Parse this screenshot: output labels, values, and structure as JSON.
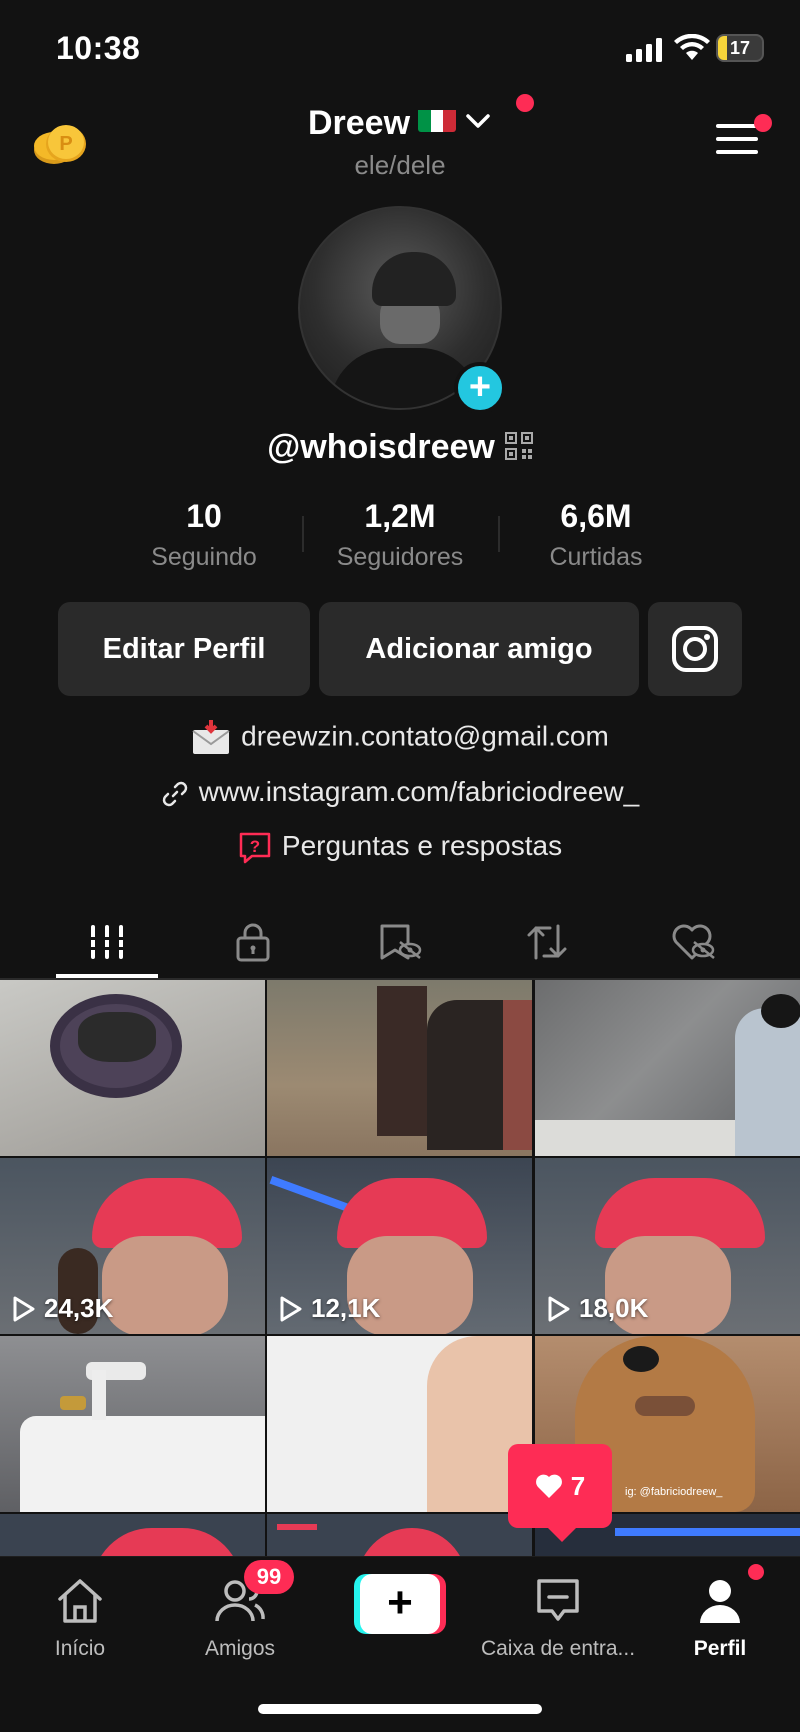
{
  "status_bar": {
    "time": "10:38",
    "battery": "17"
  },
  "header": {
    "name": "Dreew",
    "pronouns": "ele/dele"
  },
  "profile": {
    "username": "@whoisdreew",
    "stats": [
      {
        "value": "10",
        "label": "Seguindo"
      },
      {
        "value": "1,2M",
        "label": "Seguidores"
      },
      {
        "value": "6,6M",
        "label": "Curtidas"
      }
    ],
    "buttons": {
      "edit": "Editar Perfil",
      "add_friend": "Adicionar amigo"
    },
    "bio": {
      "email": "dreewzin.contato@gmail.com",
      "link": "www.instagram.com/fabriciodreew_",
      "qa": "Perguntas e respostas"
    }
  },
  "tabs": [
    "videos-icon",
    "lock-icon",
    "saved-icon",
    "repost-icon",
    "liked-icon"
  ],
  "grid": {
    "videos": [
      {
        "views": ""
      },
      {
        "views": ""
      },
      {
        "views": ""
      },
      {
        "views": "24,3K"
      },
      {
        "views": "12,1K"
      },
      {
        "views": "18,0K"
      },
      {
        "views": ""
      },
      {
        "views": ""
      },
      {
        "views": "",
        "watermark": "ig: @fabriciodreew_"
      }
    ]
  },
  "likes_popup": {
    "count": "7"
  },
  "bottom_nav": {
    "home": "Início",
    "friends": "Amigos",
    "friends_badge": "99",
    "inbox": "Caixa de entra...",
    "profile": "Perfil"
  },
  "colors": {
    "accent": "#fe2c55",
    "cyan": "#25f4ee",
    "background": "#121212"
  }
}
